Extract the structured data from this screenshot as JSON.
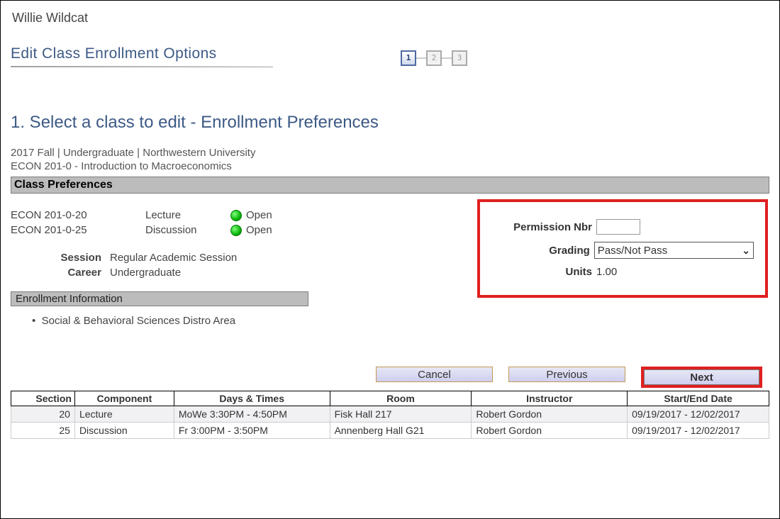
{
  "user_name": "Willie Wildcat",
  "heading": "Edit Class Enrollment Options",
  "steps": {
    "s1": "1",
    "s2": "2",
    "s3": "3"
  },
  "section_title": "1.  Select a class to edit - Enrollment Preferences",
  "term_line": "2017 Fall | Undergraduate | Northwestern University",
  "course_line": "ECON  201-0 - Introduction to Macroeconomics",
  "prefs_bar": "Class Preferences",
  "classes": [
    {
      "code": "ECON  201-0-20",
      "comp": "Lecture",
      "status": "Open"
    },
    {
      "code": "ECON  201-0-25",
      "comp": "Discussion",
      "status": "Open"
    }
  ],
  "kv": {
    "session_label": "Session",
    "session_value": "Regular Academic Session",
    "career_label": "Career",
    "career_value": "Undergraduate"
  },
  "enroll_info_bar": "Enrollment Information",
  "enroll_bullet": "Social & Behavioral Sciences Distro Area",
  "right": {
    "perm_label": "Permission Nbr",
    "perm_value": "",
    "grading_label": "Grading",
    "grading_value": "Pass/Not Pass",
    "units_label": "Units",
    "units_value": "1.00"
  },
  "buttons": {
    "cancel": "Cancel",
    "previous": "Previous",
    "next": "Next"
  },
  "table": {
    "headers": {
      "section": "Section",
      "component": "Component",
      "days": "Days & Times",
      "room": "Room",
      "instructor": "Instructor",
      "dates": "Start/End Date"
    },
    "rows": [
      {
        "section": "20",
        "component": "Lecture",
        "days": "MoWe 3:30PM - 4:50PM",
        "room": "Fisk Hall 217",
        "instructor": "Robert Gordon",
        "dates": "09/19/2017 - 12/02/2017"
      },
      {
        "section": "25",
        "component": "Discussion",
        "days": "Fr 3:00PM - 3:50PM",
        "room": "Annenberg Hall G21",
        "instructor": "Robert Gordon",
        "dates": "09/19/2017 - 12/02/2017"
      }
    ]
  }
}
